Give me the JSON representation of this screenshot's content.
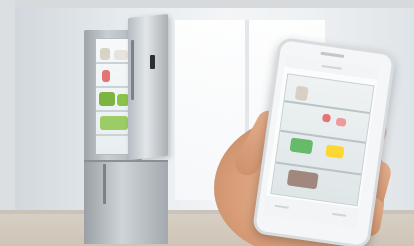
{
  "scene": {
    "subject": "smart-refrigerator-with-smartphone-app",
    "colors": {
      "wall": "#e6ebef",
      "floor": "#cfc4b6",
      "fridge_steel": "#b5bbc0",
      "skin": "#d89d78",
      "phone_body": "#f4f6f7"
    }
  }
}
